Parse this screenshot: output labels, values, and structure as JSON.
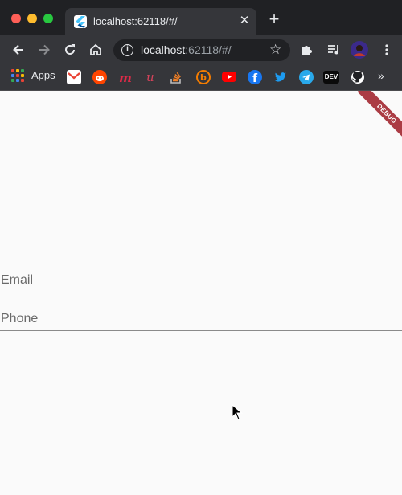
{
  "browser": {
    "tab_title": "localhost:62118/#/",
    "tab_close": "✕",
    "new_tab": "+",
    "url_host": "localhost",
    "url_rest": ":62118/#/",
    "bookmarks": {
      "apps_label": "Apps",
      "dev_label": "DEV",
      "more": "»",
      "items": [
        "gmail-icon",
        "reddit-icon",
        "medium-icon",
        "upwork-icon",
        "stackoverflow-icon",
        "blogger-icon",
        "youtube-icon",
        "facebook-icon",
        "twitter-icon",
        "telegram-icon",
        "dev-icon",
        "github-icon"
      ]
    },
    "toolbar_icons": [
      "back-icon",
      "forward-icon",
      "reload-icon",
      "home-icon",
      "info-icon",
      "star-icon",
      "extensions-icon",
      "media-icon",
      "profile-avatar"
    ]
  },
  "page": {
    "debug_banner": "DEBUG",
    "email_placeholder": "Email",
    "phone_placeholder": "Phone"
  },
  "colors": {
    "chrome_dark": "#202124",
    "chrome_toolbar": "#35363a",
    "page_background": "#fafafa",
    "debug_ribbon": "#9e1b25"
  }
}
